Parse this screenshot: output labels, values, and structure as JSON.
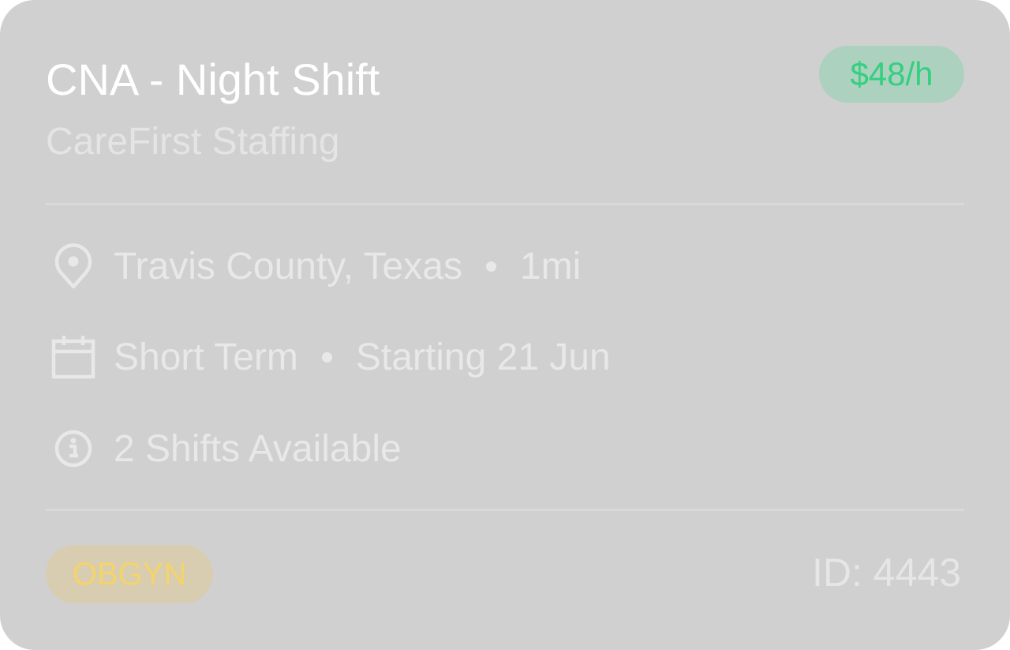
{
  "job": {
    "title": "CNA - Night Shift",
    "company": "CareFirst Staffing",
    "rate": "$48/h",
    "location": "Travis County, Texas",
    "distance": "1mi",
    "term": "Short Term",
    "start": "Starting 21 Jun",
    "shifts": "2 Shifts Available",
    "tag": "OBGYN",
    "id_label": "ID: 4443"
  },
  "icons": {
    "location": "map-pin-icon",
    "calendar": "calendar-icon",
    "info": "info-icon"
  },
  "colors": {
    "card_background": "#d0d0d0",
    "rate_text": "#33d07f",
    "rate_background": "#acd1be",
    "tag_text": "#f4d46a",
    "tag_background": "#d8cdb0"
  }
}
